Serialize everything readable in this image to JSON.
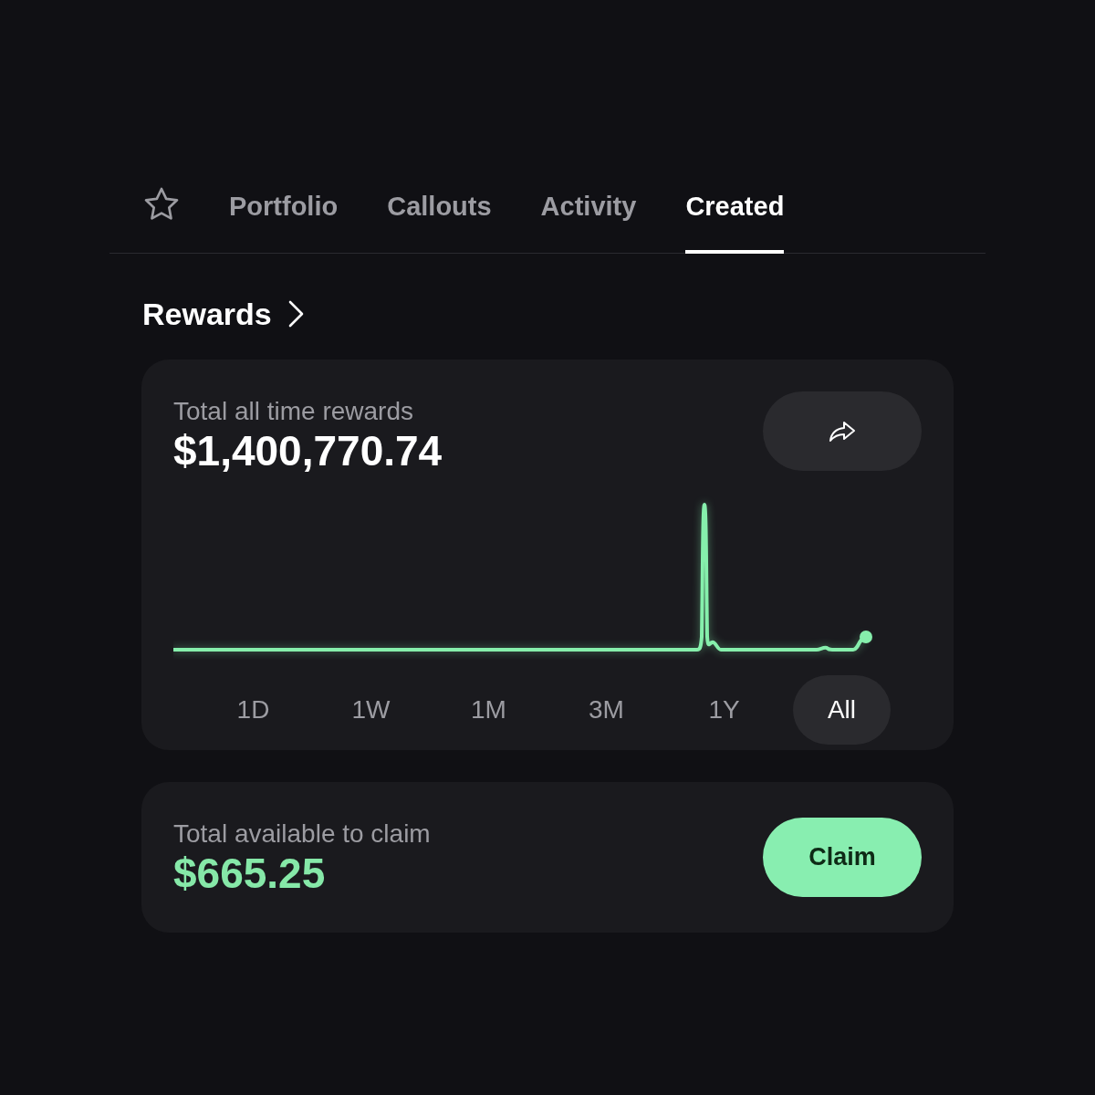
{
  "tabs": [
    {
      "label": "Portfolio",
      "selected": false
    },
    {
      "label": "Callouts",
      "selected": false
    },
    {
      "label": "Activity",
      "selected": false
    },
    {
      "label": "Created",
      "selected": true
    }
  ],
  "section": {
    "title": "Rewards"
  },
  "rewards_card": {
    "label": "Total all time rewards",
    "amount": "$1,400,770.74",
    "timeframes": [
      {
        "label": "1D",
        "selected": false
      },
      {
        "label": "1W",
        "selected": false
      },
      {
        "label": "1M",
        "selected": false
      },
      {
        "label": "3M",
        "selected": false
      },
      {
        "label": "1Y",
        "selected": false
      },
      {
        "label": "All",
        "selected": true
      }
    ]
  },
  "claim_card": {
    "label": "Total available to claim",
    "amount": "$665.25",
    "button": "Claim"
  }
}
